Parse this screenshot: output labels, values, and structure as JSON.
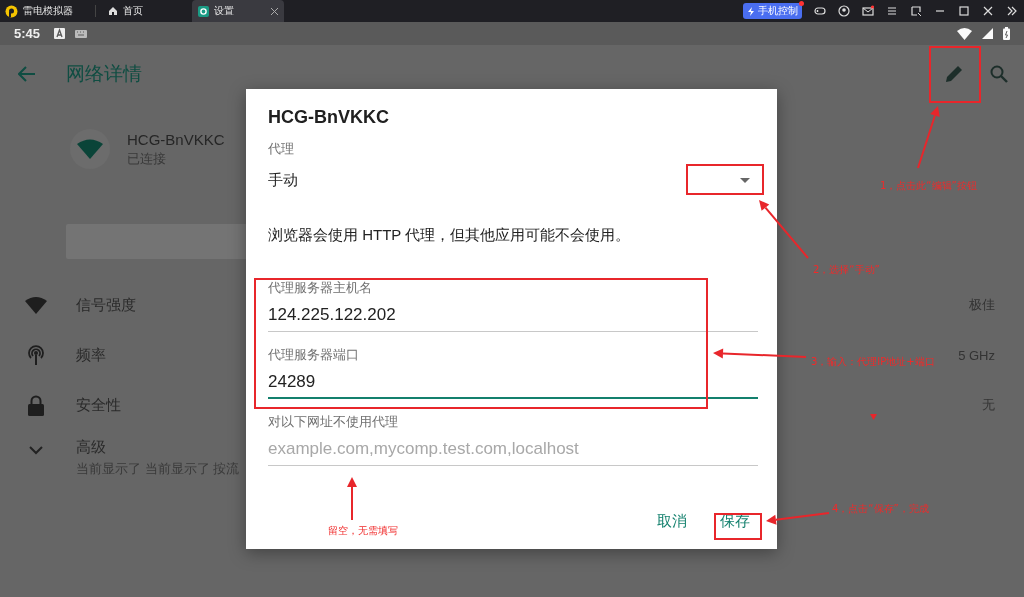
{
  "emulator": {
    "app_name": "雷电模拟器",
    "tabs": [
      {
        "label": "首页",
        "selected": false
      },
      {
        "label": "设置",
        "selected": true
      }
    ],
    "phone_control": "手机控制"
  },
  "status_bar": {
    "time": "5:45"
  },
  "header": {
    "title": "网络详情"
  },
  "network": {
    "name": "HCG-BnVKKC",
    "status": "已连接"
  },
  "details": [
    {
      "kind": "signal",
      "label": "信号强度",
      "value": "极佳"
    },
    {
      "kind": "frequency",
      "label": "频率",
      "value": "5 GHz"
    },
    {
      "kind": "security",
      "label": "安全性",
      "value": "无"
    },
    {
      "kind": "advanced",
      "label": "高级",
      "subtitle": "当前显示了 当前显示了 按流"
    }
  ],
  "dialog": {
    "title": "HCG-BnVKKC",
    "proxy_label": "代理",
    "proxy_value": "手动",
    "note": "浏览器会使用 HTTP 代理，但其他应用可能不会使用。",
    "fields": [
      {
        "label": "代理服务器主机名",
        "value": "124.225.122.202",
        "focused": false
      },
      {
        "label": "代理服务器端口",
        "value": "24289",
        "focused": true
      },
      {
        "label": "对以下网址不使用代理",
        "placeholder": "example.com,mycomp.test.com,localhost",
        "focused": false
      }
    ],
    "buttons": [
      "取消",
      "保存"
    ]
  },
  "annotations": [
    {
      "text": "1，点击此“编辑”按钮"
    },
    {
      "text": "2，选择“手动”"
    },
    {
      "text": "3，输入：代理IP地址+端口"
    },
    {
      "text": "4，点击“保存”，完成"
    },
    {
      "text": "留空，无需填写"
    }
  ]
}
